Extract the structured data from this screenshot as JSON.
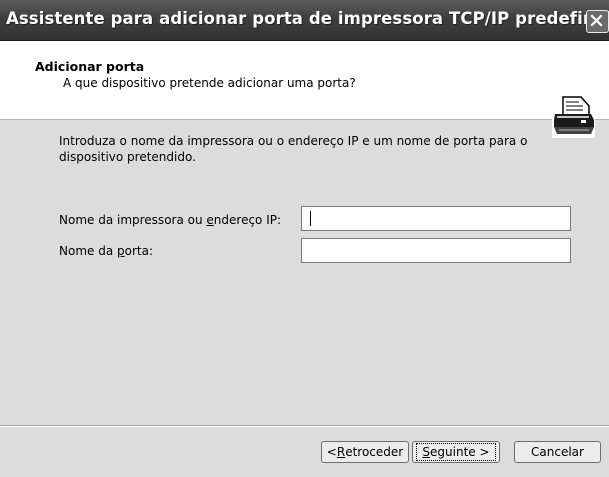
{
  "window": {
    "title": "Assistente para adicionar porta de impressora TCP/IP predefinida"
  },
  "header": {
    "title": "Adicionar porta",
    "subtitle": "A que dispositivo pretende adicionar uma porta?",
    "icon": "printer-icon"
  },
  "body": {
    "intro": "Introduza o nome da impressora ou o endereço IP e um nome de porta para o dispositivo pretendido.",
    "fields": [
      {
        "label_pre": "Nome da impressora ou ",
        "label_accel": "e",
        "label_post": "ndereço IP:",
        "value": ""
      },
      {
        "label_pre": "Nome da ",
        "label_accel": "p",
        "label_post": "orta:",
        "value": ""
      }
    ]
  },
  "buttons": {
    "back_pre": "< ",
    "back_accel": "R",
    "back_post": "etroceder",
    "next_accel": "S",
    "next_post": "eguinte >",
    "cancel": "Cancelar"
  }
}
